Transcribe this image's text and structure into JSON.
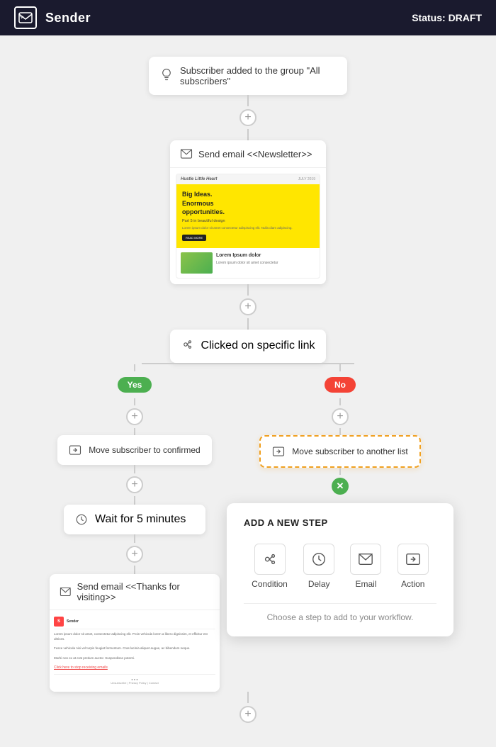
{
  "header": {
    "brand": "Sender",
    "status_label": "Status:",
    "status_value": "DRAFT"
  },
  "workflow": {
    "trigger": {
      "label": "Subscriber added to the group \"All subscribers\""
    },
    "email1": {
      "label": "Send email <<Newsletter>>"
    },
    "condition": {
      "label": "Clicked on specific link"
    },
    "yes_badge": "Yes",
    "no_badge": "No",
    "left_action": {
      "label": "Move subscriber to confirmed"
    },
    "right_action": {
      "label": "Move subscriber to another list"
    },
    "wait": {
      "label": "Wait for 5 minutes"
    },
    "email2": {
      "label": "Send email <<Thanks for visiting>>"
    }
  },
  "add_step_panel": {
    "title": "ADD A NEW STEP",
    "options": [
      {
        "icon": "condition",
        "label": "Condition"
      },
      {
        "icon": "delay",
        "label": "Delay"
      },
      {
        "icon": "email",
        "label": "Email"
      },
      {
        "icon": "action",
        "label": "Action"
      }
    ],
    "hint": "Choose a step to add to your workflow."
  },
  "email_preview": {
    "title": "Hustle Little Heart",
    "date": "JULY 2019",
    "hero_line1": "Big Ideas.",
    "hero_line2": "Enormous",
    "hero_line3": "opportunities.",
    "hero_sub": "Part 5 in beautiful design",
    "body_title": "Lorem Ipsum dolor",
    "body_text": "Lorem ipsum dolor sit amet consectetur",
    "btn": "READ MORE"
  }
}
